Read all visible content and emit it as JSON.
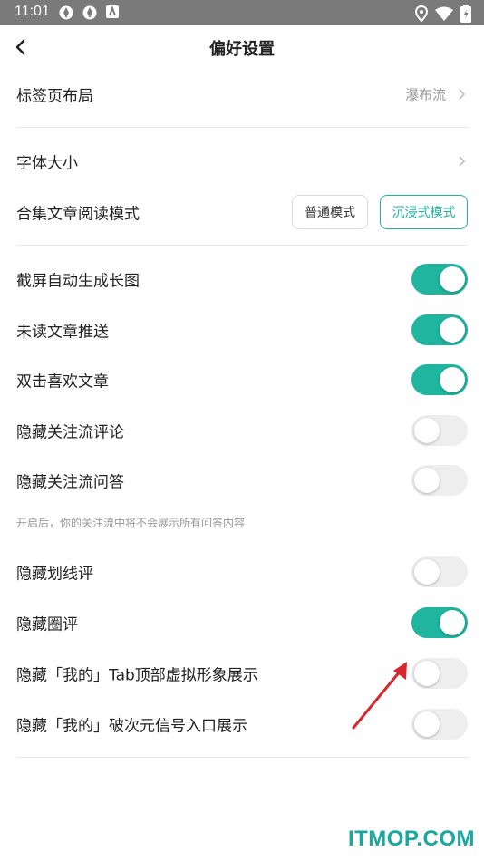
{
  "status_bar": {
    "time": "11:01",
    "icons": [
      "notification-icon",
      "notification-icon",
      "app-icon",
      "location-icon",
      "wifi-icon",
      "battery-icon"
    ]
  },
  "header": {
    "title": "偏好设置",
    "back_icon": "chevron-left-icon"
  },
  "rows": {
    "tab_layout": {
      "label": "标签页布局",
      "value": "瀑布流"
    },
    "font_size": {
      "label": "字体大小"
    },
    "collection_mode": {
      "label": "合集文章阅读模式",
      "options": [
        "普通模式",
        "沉浸式模式"
      ],
      "selected": "沉浸式模式"
    },
    "screenshot_long": {
      "label": "截屏自动生成长图",
      "on": true
    },
    "unread_push": {
      "label": "未读文章推送",
      "on": true
    },
    "double_tap_like": {
      "label": "双击喜欢文章",
      "on": true
    },
    "hide_follow_comments": {
      "label": "隐藏关注流评论",
      "on": false
    },
    "hide_follow_qa": {
      "label": "隐藏关注流问答",
      "on": false
    },
    "hide_follow_qa_hint": "开启后，你的关注流中将不会展示所有问答内容",
    "hide_underline_comments": {
      "label": "隐藏划线评",
      "on": false
    },
    "hide_circle_comments": {
      "label": "隐藏圈评",
      "on": true
    },
    "hide_tab_avatar": {
      "label": "隐藏「我的」Tab顶部虚拟形象展示",
      "on": false
    },
    "hide_ciyuan_entry": {
      "label": "隐藏「我的」破次元信号入口展示",
      "on": false
    }
  },
  "colors": {
    "accent": "#1fb59f",
    "status_bar": "#7a7a7a",
    "arrow": "#d8272d"
  },
  "watermark": "ITMOP.COM"
}
